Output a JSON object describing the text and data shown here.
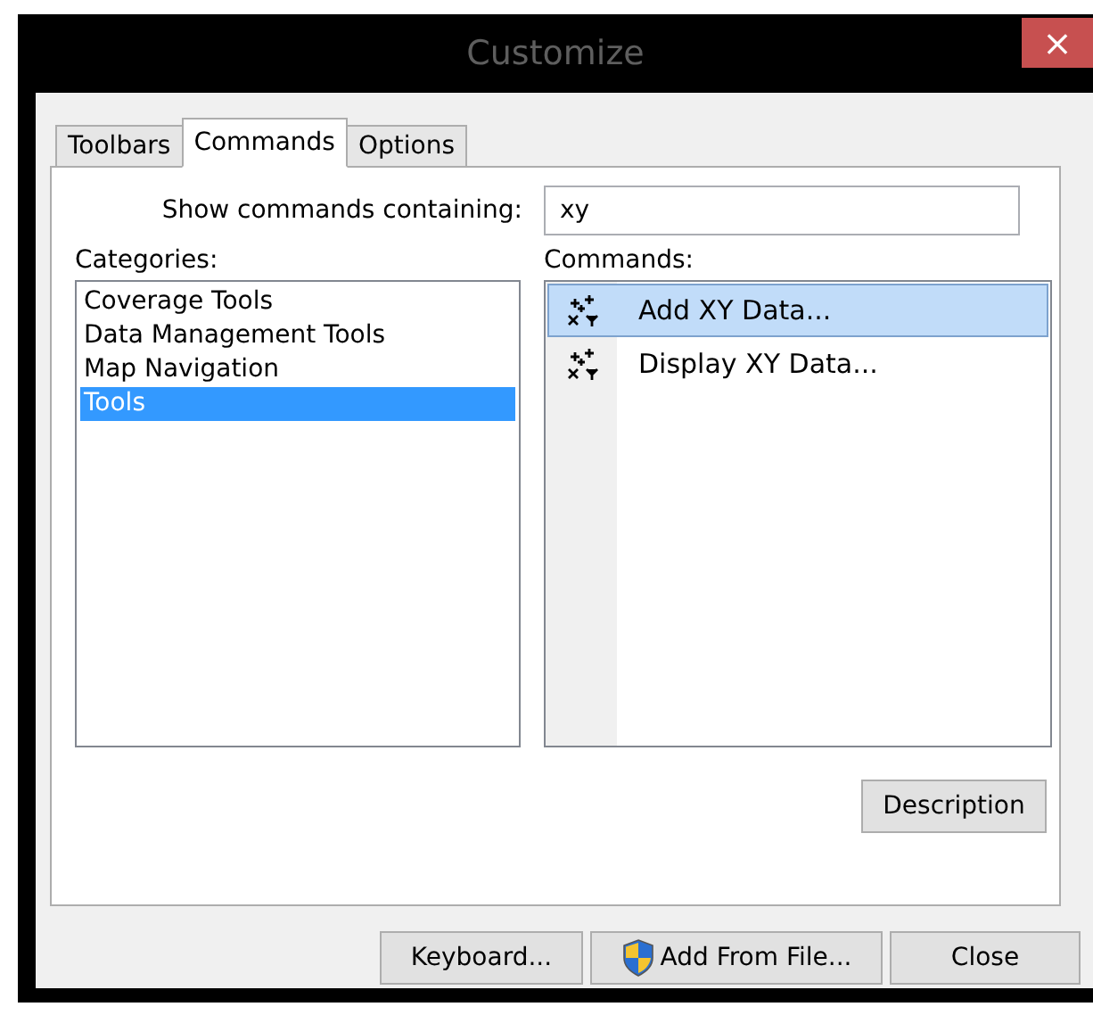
{
  "window": {
    "title": "Customize",
    "close": "×"
  },
  "tabs": [
    {
      "label": "Toolbars",
      "selected": false
    },
    {
      "label": "Commands",
      "selected": true
    },
    {
      "label": "Options",
      "selected": false
    }
  ],
  "search": {
    "label": "Show commands containing:",
    "value": "xy"
  },
  "categories": {
    "label": "Categories:",
    "items": [
      {
        "label": "Coverage Tools",
        "selected": false
      },
      {
        "label": "Data Management Tools",
        "selected": false
      },
      {
        "label": "Map Navigation",
        "selected": false
      },
      {
        "label": "Tools",
        "selected": true
      }
    ]
  },
  "commands": {
    "label": "Commands:",
    "items": [
      {
        "label": "Add XY Data...",
        "selected": true
      },
      {
        "label": "Display XY Data...",
        "selected": false
      }
    ]
  },
  "description_button": "Description",
  "buttons": [
    {
      "label": "Keyboard...",
      "kind": "plain"
    },
    {
      "label": "Add From File...",
      "kind": "shield"
    },
    {
      "label": "Close",
      "kind": "plain"
    }
  ]
}
